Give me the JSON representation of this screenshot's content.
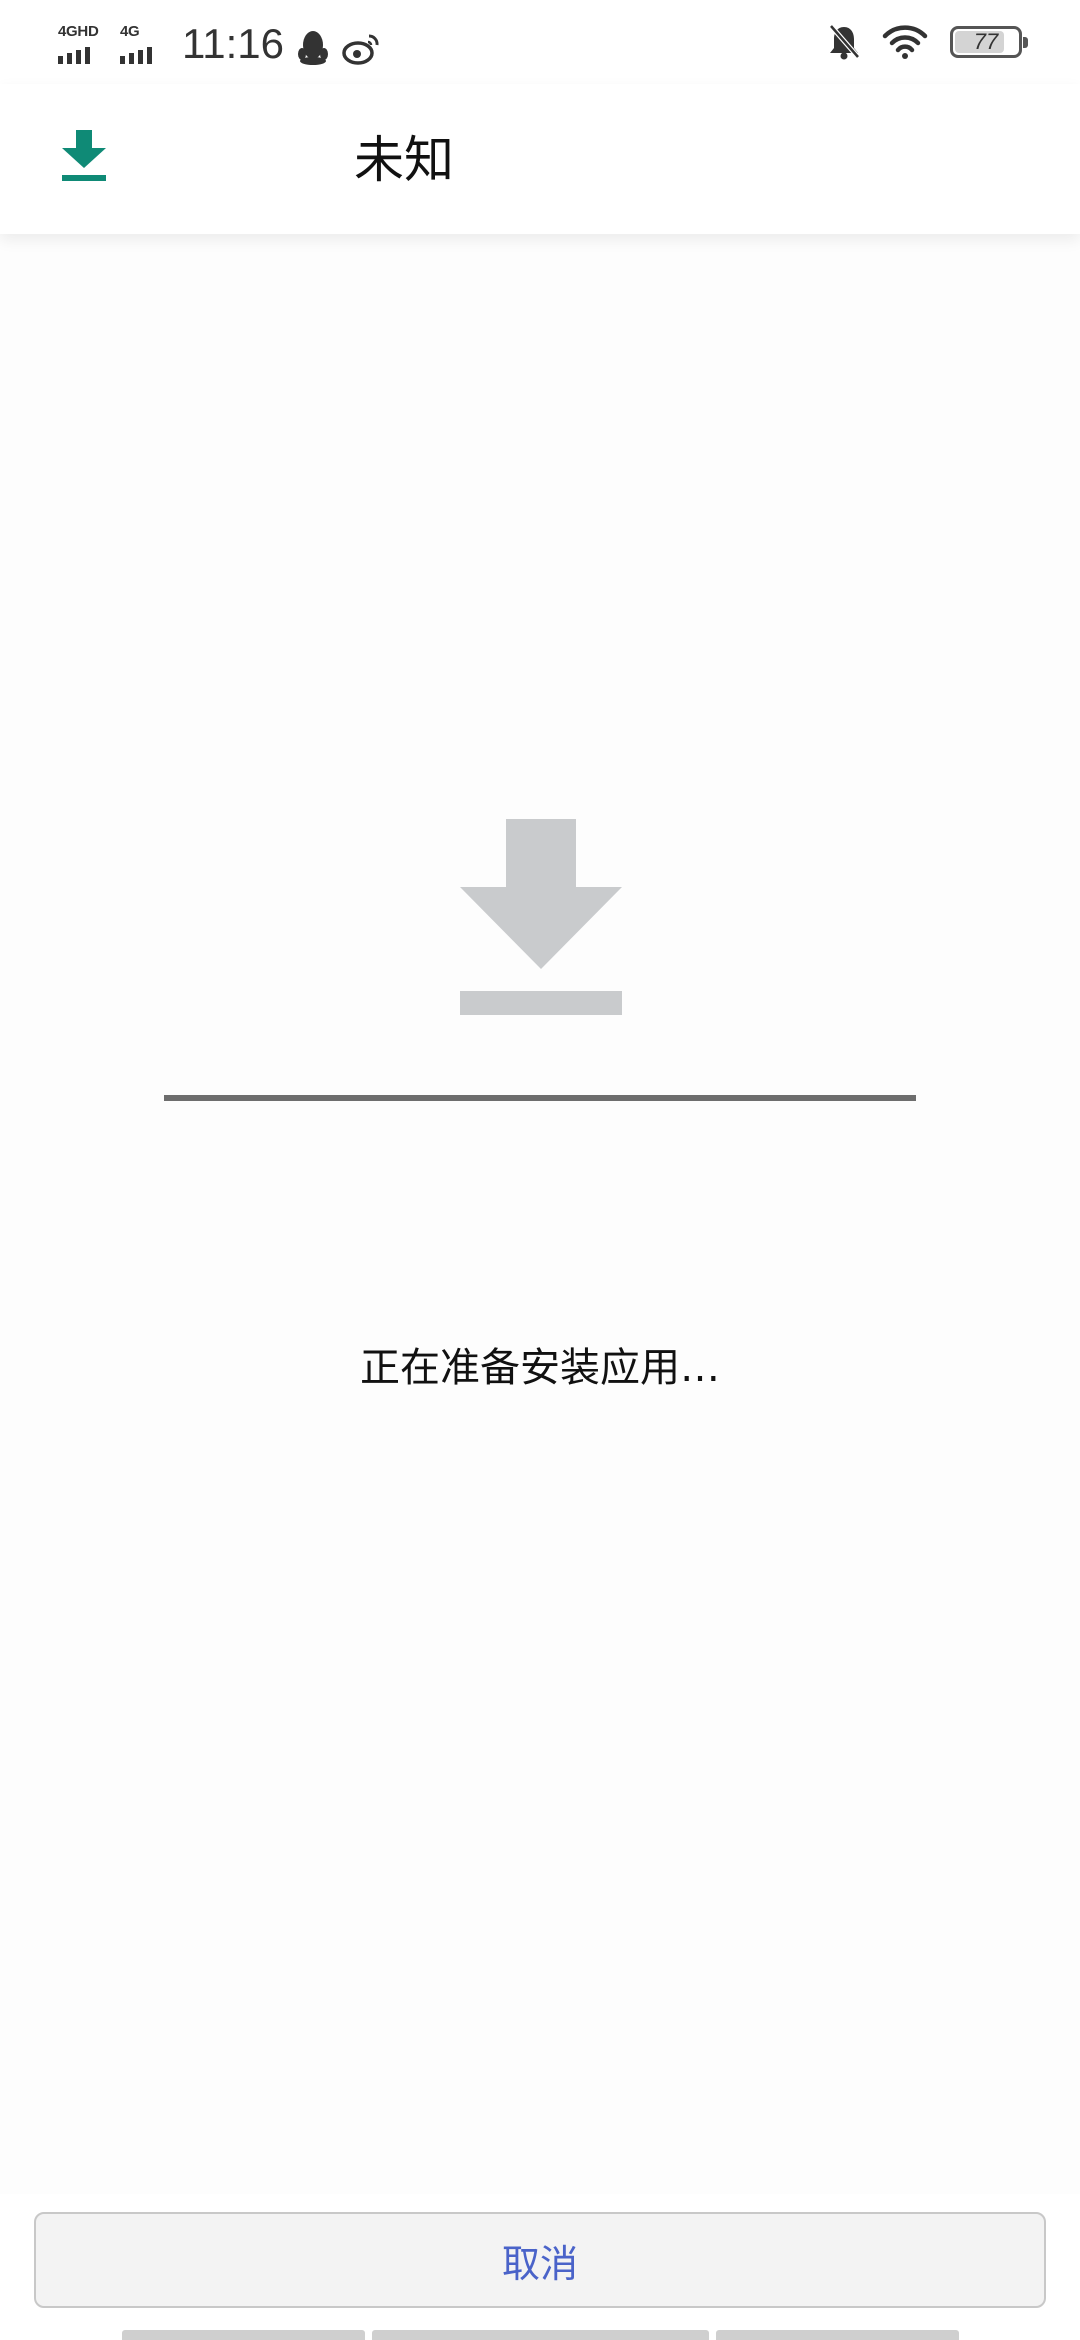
{
  "status_bar": {
    "network_1": "4GHD",
    "network_2": "4G",
    "time": "11:16",
    "battery": "77",
    "battery_level": 0.77
  },
  "app_bar": {
    "title": "未知",
    "icon": "download-icon"
  },
  "install": {
    "icon": "download-icon",
    "status_text": "正在准备安装应用…",
    "progress": "indeterminate"
  },
  "actions": {
    "cancel_label": "取消"
  },
  "colors": {
    "accent": "#0f8a76",
    "icon_gray": "#c9cbcd",
    "button_text": "#4a63c9"
  }
}
